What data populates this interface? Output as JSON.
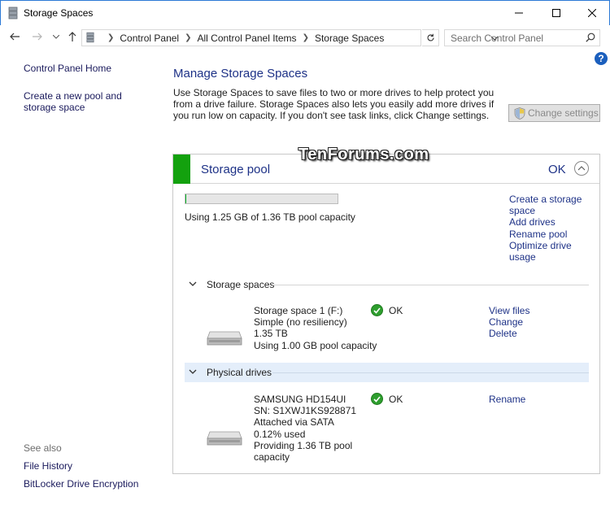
{
  "window": {
    "title": "Storage Spaces",
    "icon": "storage-spaces-icon"
  },
  "address_bar": {
    "crumbs": [
      "Control Panel",
      "All Control Panel Items",
      "Storage Spaces"
    ],
    "search_placeholder": "Search Control Panel"
  },
  "left_pane": {
    "home": "Control Panel Home",
    "create_pool": "Create a new pool and storage space",
    "see_also": "See also",
    "file_history": "File History",
    "bitlocker": "BitLocker Drive Encryption"
  },
  "main": {
    "title": "Manage Storage Spaces",
    "description": "Use Storage Spaces to save files to two or more drives to help protect you from a drive failure. Storage Spaces also lets you easily add more drives if you run low on capacity. If you don't see task links, click Change settings.",
    "change_settings": "Change settings"
  },
  "watermark": "TenForums.com",
  "pool": {
    "title": "Storage pool",
    "status": "OK",
    "usage_fraction": 0.0009,
    "usage_text": "Using 1.25 GB of 1.36 TB pool capacity",
    "links": [
      "Create a storage space",
      "Add drives",
      "Rename pool",
      "Optimize drive usage"
    ]
  },
  "storage_spaces": {
    "heading": "Storage spaces",
    "item": {
      "lines": [
        "Storage space 1 (F:)",
        "Simple (no resiliency)",
        "1.35 TB",
        "Using 1.00 GB pool capacity"
      ],
      "status": "OK",
      "links": [
        "View files",
        "Change",
        "Delete"
      ]
    }
  },
  "physical_drives": {
    "heading": "Physical drives",
    "item": {
      "lines": [
        "SAMSUNG HD154UI",
        "SN: S1XWJ1KS928871",
        "Attached via SATA",
        "0.12% used",
        "Providing 1.36 TB pool capacity"
      ],
      "status": "OK",
      "links": [
        "Rename"
      ]
    }
  },
  "colors": {
    "accent": "#1e3287",
    "ok_green": "#13a10e",
    "title_border": "#2b79d6"
  }
}
